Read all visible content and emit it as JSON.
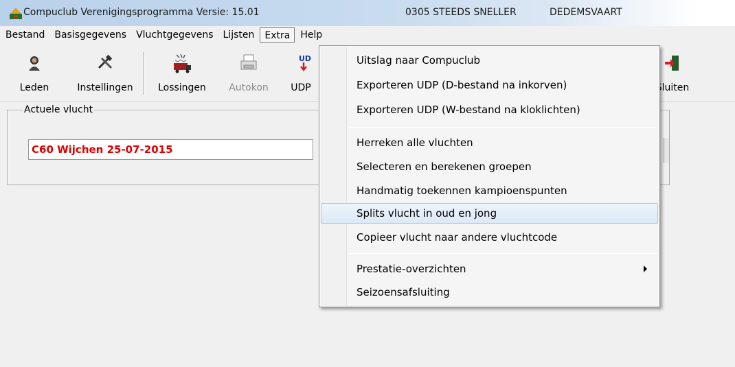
{
  "titlebar": {
    "app": "Compuclub Verenigingsprogramma Versie: 15.01",
    "club": "0305 STEEDS SNELLER",
    "place": "DEDEMSVAART"
  },
  "menubar": {
    "items": [
      "Bestand",
      "Basisgegevens",
      "Vluchtgegevens",
      "Lijsten",
      "Extra",
      "Help"
    ]
  },
  "toolbar": {
    "leden": "Leden",
    "instellingen": "Instellingen",
    "lossingen": "Lossingen",
    "autokon": "Autokon",
    "udp": "UDP",
    "sluiten": "Sluiten"
  },
  "actuele_vlucht": {
    "label": "Actuele vlucht",
    "value": "C60 Wijchen 25-07-2015"
  },
  "extra_menu": {
    "items": [
      "Uitslag naar Compuclub",
      "Exporteren UDP (D-bestand na inkorven)",
      "Exporteren UDP (W-bestand na kloklichten)",
      "Herreken alle vluchten",
      "Selecteren en berekenen groepen",
      "Handmatig toekennen kampioenspunten",
      "Splits vlucht in oud en jong",
      "Copieer vlucht naar andere vluchtcode",
      "Prestatie-overzichten",
      "Seizoensafsluiting"
    ]
  },
  "colors": {
    "flight_text": "#e00000",
    "menu_hover": "#dde9f7"
  }
}
